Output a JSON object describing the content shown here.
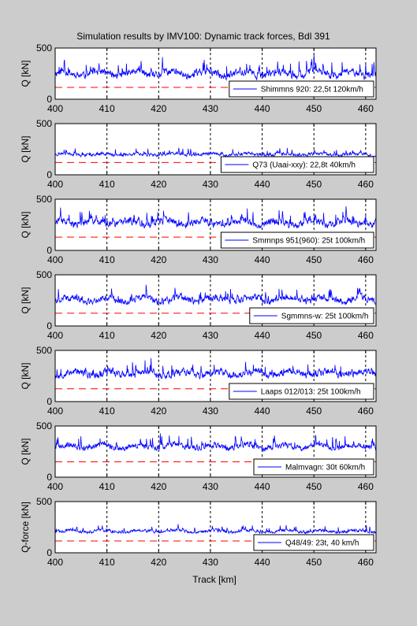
{
  "figure": {
    "title": "Simulation results by IMV100: Dynamic track forces, Bdl 391",
    "xlabel": "Track [km]",
    "background": "#cccccc"
  },
  "chart_data": [
    {
      "type": "line",
      "ylabel": "Q [kN]",
      "xlim": [
        400,
        462
      ],
      "ylim": [
        0,
        500
      ],
      "x_ticks": [
        400,
        410,
        420,
        430,
        440,
        450,
        460
      ],
      "y_ticks": [
        0,
        500
      ],
      "legend": "Shimmns 920: 22,5t 120km/h",
      "legend_position": "bottom-right",
      "threshold_line": 115,
      "series": {
        "color": "#0000ff",
        "baseline": 250,
        "amplitude": 60,
        "peak_max": 495,
        "seed": 11
      },
      "vertical_dashed_lines_km": [
        400,
        410,
        420,
        430,
        440,
        450,
        460
      ],
      "grid": false
    },
    {
      "type": "line",
      "ylabel": "Q [kN]",
      "xlim": [
        400,
        462
      ],
      "ylim": [
        0,
        500
      ],
      "x_ticks": [
        400,
        410,
        420,
        430,
        440,
        450,
        460
      ],
      "y_ticks": [
        0,
        500
      ],
      "legend": "Q73 (Uaai-xxy): 22,8t 40km/h",
      "legend_position": "bottom-right",
      "threshold_line": 120,
      "series": {
        "color": "#0000ff",
        "baseline": 200,
        "amplitude": 25,
        "peak_max": 300,
        "seed": 23
      },
      "vertical_dashed_lines_km": [
        400,
        410,
        420,
        430,
        440,
        450,
        460
      ],
      "grid": false
    },
    {
      "type": "line",
      "ylabel": "Q [kN]",
      "xlim": [
        400,
        462
      ],
      "ylim": [
        0,
        500
      ],
      "x_ticks": [
        400,
        410,
        420,
        430,
        440,
        450,
        460
      ],
      "y_ticks": [
        0,
        500
      ],
      "legend": "Smmnps 951(960): 25t 100km/h",
      "legend_position": "bottom-right",
      "threshold_line": 130,
      "series": {
        "color": "#0000ff",
        "baseline": 270,
        "amplitude": 60,
        "peak_max": 480,
        "seed": 37
      },
      "vertical_dashed_lines_km": [
        400,
        410,
        420,
        430,
        440,
        450,
        460
      ],
      "grid": false
    },
    {
      "type": "line",
      "ylabel": "Q [kN]",
      "xlim": [
        400,
        462
      ],
      "ylim": [
        0,
        500
      ],
      "x_ticks": [
        400,
        410,
        420,
        430,
        440,
        450,
        460
      ],
      "y_ticks": [
        0,
        500
      ],
      "legend": "Sgmmns-w: 25t 100km/h",
      "legend_position": "bottom-right",
      "threshold_line": 125,
      "series": {
        "color": "#0000ff",
        "baseline": 260,
        "amplitude": 55,
        "peak_max": 460,
        "seed": 41
      },
      "vertical_dashed_lines_km": [
        400,
        410,
        420,
        430,
        440,
        450,
        460
      ],
      "grid": false
    },
    {
      "type": "line",
      "ylabel": "Q [kN]",
      "xlim": [
        400,
        462
      ],
      "ylim": [
        0,
        500
      ],
      "x_ticks": [
        400,
        410,
        420,
        430,
        440,
        450,
        460
      ],
      "y_ticks": [
        0,
        500
      ],
      "legend": "Laaps 012/013: 25t 100km/h",
      "legend_position": "bottom-right",
      "threshold_line": 125,
      "series": {
        "color": "#0000ff",
        "baseline": 275,
        "amplitude": 60,
        "peak_max": 480,
        "seed": 53
      },
      "vertical_dashed_lines_km": [
        400,
        410,
        420,
        430,
        440,
        450,
        460
      ],
      "grid": false
    },
    {
      "type": "line",
      "ylabel": "Q [kN]",
      "xlim": [
        400,
        462
      ],
      "ylim": [
        0,
        500
      ],
      "x_ticks": [
        400,
        410,
        420,
        430,
        440,
        450,
        460
      ],
      "y_ticks": [
        0,
        500
      ],
      "legend": "Malmvagn: 30t 60km/h",
      "legend_position": "bottom-right",
      "threshold_line": 150,
      "series": {
        "color": "#0000ff",
        "baseline": 300,
        "amplitude": 45,
        "peak_max": 470,
        "seed": 67
      },
      "vertical_dashed_lines_km": [
        400,
        410,
        420,
        430,
        440,
        450,
        460
      ],
      "grid": false
    },
    {
      "type": "line",
      "ylabel": "Q-force [kN]",
      "xlim": [
        400,
        462
      ],
      "ylim": [
        0,
        500
      ],
      "x_ticks": [
        400,
        410,
        420,
        430,
        440,
        450,
        460
      ],
      "y_ticks": [
        0,
        500
      ],
      "legend": "Q48/49: 23t, 40 km/h",
      "legend_position": "bottom-right",
      "threshold_line": 115,
      "series": {
        "color": "#0000ff",
        "baseline": 210,
        "amplitude": 25,
        "peak_max": 300,
        "seed": 79
      },
      "vertical_dashed_lines_km": [
        400,
        410,
        420,
        430,
        440,
        450,
        460
      ],
      "grid": false
    }
  ]
}
